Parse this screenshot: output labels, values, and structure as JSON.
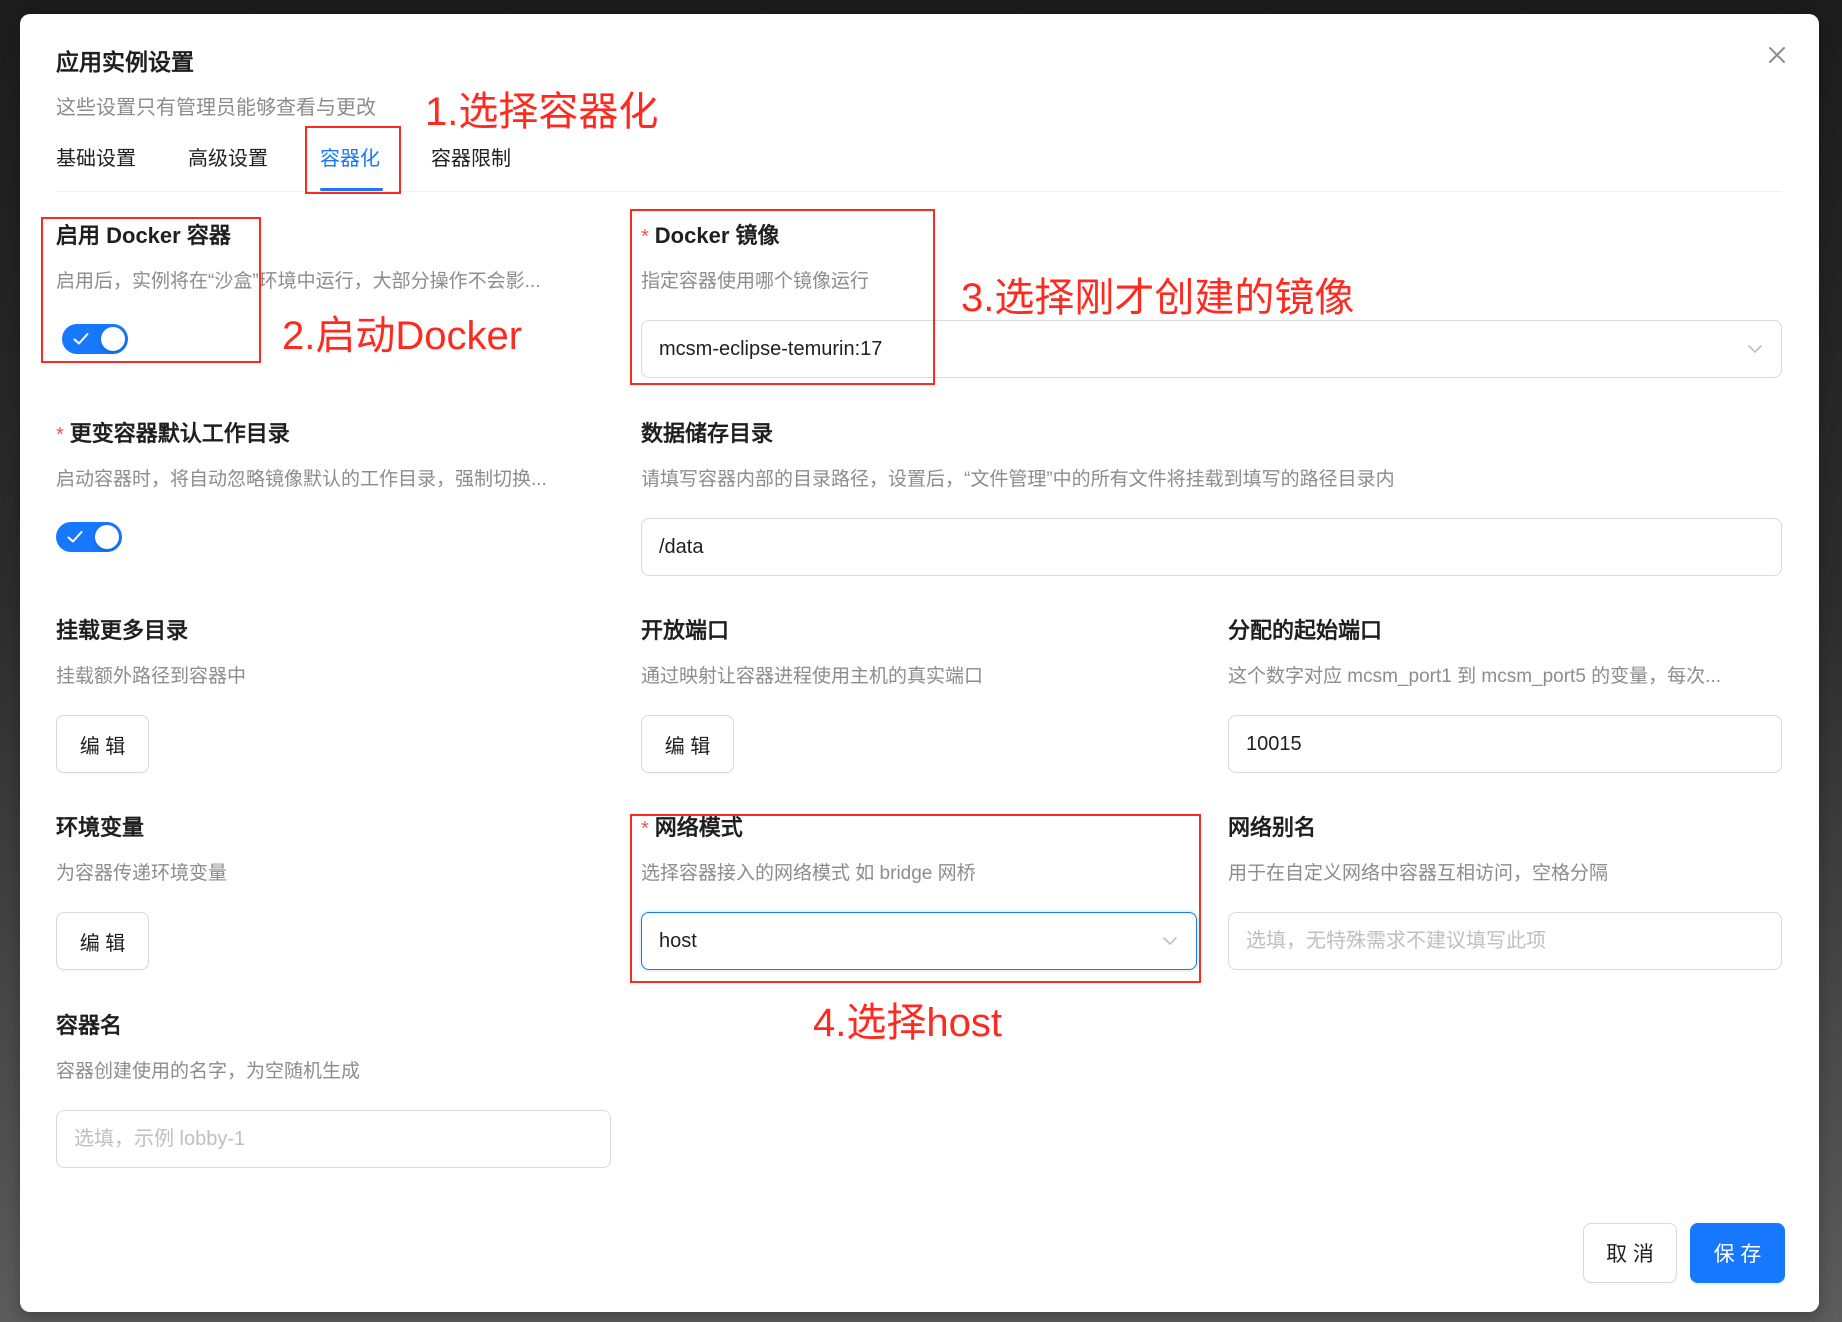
{
  "dialog": {
    "title": "应用实例设置",
    "subtitle": "这些设置只有管理员能够查看与更改",
    "tabs": [
      {
        "label": "基础设置",
        "active": false
      },
      {
        "label": "高级设置",
        "active": false
      },
      {
        "label": "容器化",
        "active": true
      },
      {
        "label": "容器限制",
        "active": false
      }
    ]
  },
  "form": {
    "docker_enable": {
      "label": "启用 Docker 容器",
      "description": "启用后，实例将在“沙盒”环境中运行，大部分操作不会影...",
      "checked": true
    },
    "docker_image": {
      "required_mark": "*",
      "label": "Docker 镜像",
      "description": "指定容器使用哪个镜像运行",
      "value": "mcsm-eclipse-temurin:17"
    },
    "change_workdir": {
      "required_mark": "*",
      "label": "更变容器默认工作目录",
      "description": "启动容器时，将自动忽略镜像默认的工作目录，强制切换...",
      "checked": true
    },
    "data_dir": {
      "label": "数据储存目录",
      "description": "请填写容器内部的目录路径，设置后，“文件管理”中的所有文件将挂载到填写的路径目录内",
      "value": "/data"
    },
    "extra_mounts": {
      "label": "挂载更多目录",
      "description": "挂载额外路径到容器中",
      "button": "编 辑"
    },
    "ports": {
      "label": "开放端口",
      "description": "通过映射让容器进程使用主机的真实端口",
      "button": "编 辑"
    },
    "start_port": {
      "label": "分配的起始端口",
      "description": "这个数字对应 mcsm_port1 到 mcsm_port5 的变量，每次...",
      "value": "10015"
    },
    "env": {
      "label": "环境变量",
      "description": "为容器传递环境变量",
      "button": "编 辑"
    },
    "network_mode": {
      "required_mark": "*",
      "label": "网络模式",
      "description": "选择容器接入的网络模式 如 bridge 网桥",
      "value": "host"
    },
    "network_alias": {
      "label": "网络别名",
      "description": "用于在自定义网络中容器互相访问，空格分隔",
      "placeholder": "选填，无特殊需求不建议填写此项"
    },
    "container_name": {
      "label": "容器名",
      "description": "容器创建使用的名字，为空随机生成",
      "placeholder": "选填，示例 lobby-1"
    }
  },
  "footer": {
    "cancel_label": "取 消",
    "save_label": "保 存"
  },
  "annotations": {
    "step1": "1.选择容器化",
    "step2": "2.启动Docker",
    "step3": "3.选择刚才创建的镜像",
    "step4": "4.选择host"
  },
  "icons": {
    "close": "close-icon",
    "select_arrow": "chevron-down-icon",
    "switch_on": "check-icon"
  },
  "colors": {
    "primary": "#1677ff",
    "annotation": "#ff2a1f",
    "required": "#ff4d4f",
    "description_text": "#8c8c8c",
    "border": "#d9d9d9"
  }
}
